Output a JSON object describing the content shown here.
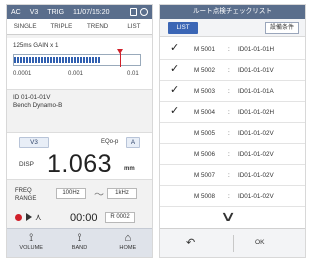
{
  "left_screen": {
    "status": {
      "mode": "AC",
      "v": "V3",
      "trig": "TRIG",
      "datetime": "11/07/15:20"
    },
    "tabs": [
      "SINGLE",
      "TRIPLE",
      "TREND",
      "LIST"
    ],
    "gain": {
      "label": "125ms  GAIN x 1",
      "bar_level_fraction": 0.68,
      "marker_fraction": 0.84
    },
    "scale_labels": [
      "0.0001",
      "0.001",
      "0.01"
    ],
    "device": {
      "id": "ID 01-01-01V",
      "name": "Bench Dynamo-B"
    },
    "channel": "V3",
    "eq_label": "EQo-p",
    "eq_value": "A",
    "disp": {
      "label": "DISP",
      "value": "1.063",
      "unit": "mm"
    },
    "freq": {
      "label_line1": "FREQ",
      "label_line2": "RANGE",
      "low": "100Hz",
      "tilde": "〜",
      "high": "1kHz"
    },
    "record": {
      "time": "00:00",
      "record_id": "R 0002"
    },
    "nav": [
      {
        "label": "VOLUME",
        "icon": "volume-icon"
      },
      {
        "label": "BAND",
        "icon": "band-icon"
      },
      {
        "label": "HOME",
        "icon": "home-icon"
      }
    ]
  },
  "right_screen": {
    "title": "ルート点検チェックリスト",
    "list_button": "LIST",
    "condition_button": "設備条件",
    "rows": [
      {
        "id": "M 5001",
        "loc": "ID01-01-01H",
        "checked": true
      },
      {
        "id": "M 5002",
        "loc": "ID01-01-01V",
        "checked": true
      },
      {
        "id": "M 5003",
        "loc": "ID01-01-01A",
        "checked": true
      },
      {
        "id": "M 5004",
        "loc": "ID01-01-02H",
        "checked": true
      },
      {
        "id": "M 5005",
        "loc": "ID01-01-02V",
        "checked": false
      },
      {
        "id": "M 5006",
        "loc": "ID01-01-02V",
        "checked": false
      },
      {
        "id": "M 5007",
        "loc": "ID01-01-02V",
        "checked": false
      },
      {
        "id": "M 5008",
        "loc": "ID01-01-02V",
        "checked": false
      }
    ],
    "colon": ":",
    "ok_label": "OK"
  },
  "colors": {
    "header": "#5a6e8c",
    "accent": "#3b66b5",
    "marker": "#d0202a"
  }
}
